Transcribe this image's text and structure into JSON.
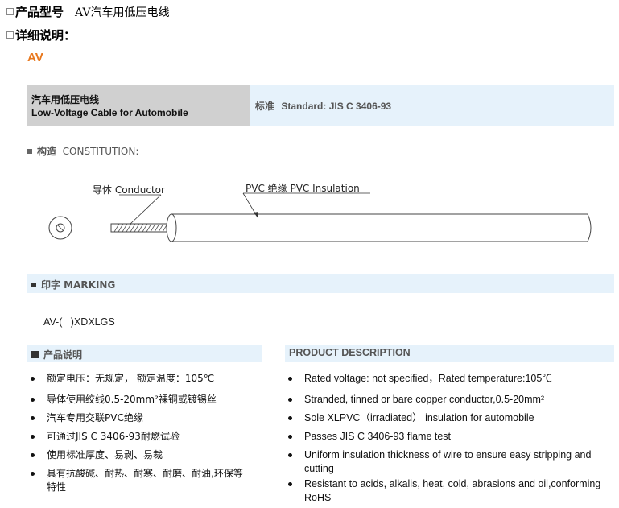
{
  "header": {
    "model_label": "产品型号",
    "model_value": "AV汽车用低压电线",
    "detail_label": "详细说明："
  },
  "product_code": "AV",
  "title_box": {
    "cn": "汽车用低压电线",
    "en": "Low-Voltage Cable for Automobile",
    "standard_cn": "标准",
    "standard_en": "Standard: JIS C 3406-93"
  },
  "constitution": {
    "label": "构造",
    "label_en": "CONSTITUTION:",
    "conductor_label": "导体 Conductor",
    "insulation_label": "PVC 绝缘 PVC Insulation"
  },
  "marking": {
    "label": "印字 MARKING",
    "text": "AV-(   )XDXLGS"
  },
  "desc_cn": {
    "title": "产品说明",
    "items": [
      "额定电压：无规定，  额定温度：105℃",
      "导体使用绞线0.5-20mm²裸铜或镀锡丝",
      "汽车专用交联PVC绝缘",
      "可通过JIS C 3406-93耐燃试验",
      "使用标准厚度、易剥、易裁",
      "具有抗酸碱、耐热、耐寒、耐磨、耐油,环保等特性"
    ]
  },
  "desc_en": {
    "title": "PRODUCT DESCRIPTION",
    "items": [
      "Rated voltage: not specified，Rated temperature:105℃",
      "Stranded, tinned or bare copper conductor,0.5-20mm²",
      "Sole XLPVC（irradiated） insulation for automobile",
      "Passes JIS C 3406-93 flame test",
      "Uniform insulation thickness of wire to ensure easy stripping and cutting",
      "Resistant to acids, alkalis, heat, cold, abrasions and oil,conforming RoHS"
    ]
  },
  "colors": {
    "accent_orange": "#e8781e",
    "bar_blue": "#e6f2fb",
    "box_gray": "#d0d0d0"
  }
}
